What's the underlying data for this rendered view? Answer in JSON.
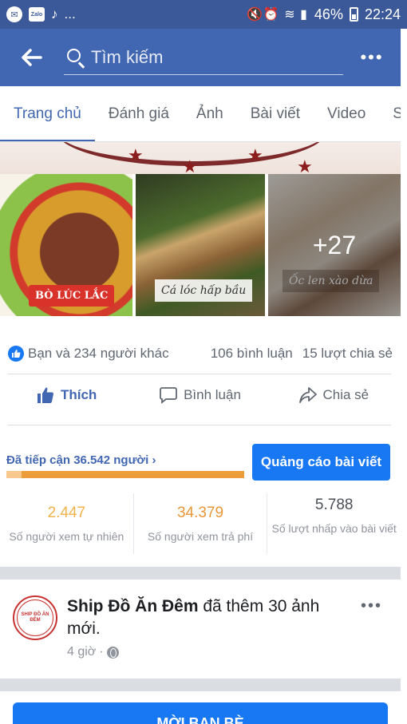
{
  "status_bar": {
    "left_ellipsis": "...",
    "battery": "46%",
    "time": "22:24",
    "icons": [
      "messenger-icon",
      "zalo-icon",
      "tiktok-icon",
      "mute-icon",
      "alarm-icon",
      "wifi-icon",
      "signal-icon",
      "battery-icon"
    ]
  },
  "header": {
    "search_placeholder": "Tìm kiếm",
    "more_label": "•••"
  },
  "tabs": [
    {
      "label": "Trang chủ",
      "active": true
    },
    {
      "label": "Đánh giá"
    },
    {
      "label": "Ảnh"
    },
    {
      "label": "Bài viết"
    },
    {
      "label": "Video"
    },
    {
      "label": "S"
    }
  ],
  "photos": {
    "items": [
      {
        "caption": "BÒ LÚC LẮC"
      },
      {
        "caption": "Cá lóc hấp bầu"
      },
      {
        "caption": "Ốc len xào dừa"
      }
    ],
    "more_count": "+27"
  },
  "reactions": {
    "summary": "Bạn và 234 người khác",
    "comments": "106 bình luận",
    "shares": "15 lượt chia sẻ"
  },
  "actions": {
    "like": "Thích",
    "comment": "Bình luận",
    "share": "Chia sẻ"
  },
  "promotion": {
    "reach": "Đã tiếp cận 36.542 người",
    "reach_chevron": "›",
    "organic_share": 0.065,
    "boost_button": "Quảng cáo bài viết",
    "stats": [
      {
        "value": "2.447",
        "label": "Số người xem tự nhiên"
      },
      {
        "value": "34.379",
        "label": "Số người xem trả phí"
      },
      {
        "value": "5.788",
        "label": "Số lượt nhấp vào bài viết"
      }
    ]
  },
  "post": {
    "page_name": "Ship Đồ Ăn Đêm",
    "action_text": " đã thêm 30 ảnh mới.",
    "time": "4 giờ",
    "separator": "·",
    "avatar_text": "SHIP ĐỒ ĂN ĐÊM",
    "more_label": "•••"
  },
  "invite_button": "MỜI BẠN BÈ",
  "colors": {
    "status_bar": "#3b5998",
    "header": "#4267b2",
    "accent": "#1877f2",
    "orange": "#ec9d3a"
  }
}
